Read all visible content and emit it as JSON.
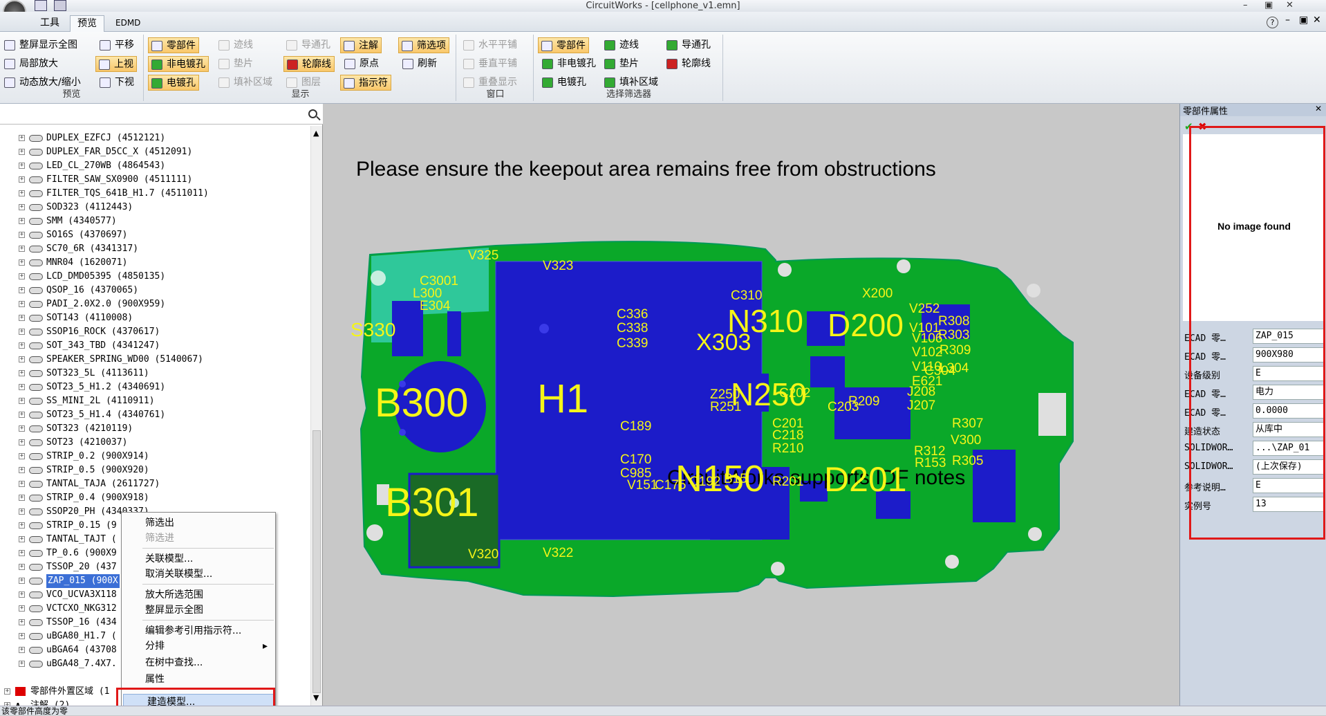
{
  "window": {
    "title": "CircuitWorks - [cellphone_v1.emn]",
    "help_glyph": "?",
    "controls": [
      "–",
      "▣",
      "✕"
    ]
  },
  "tabs": [
    "工具",
    "预览",
    "EDMD"
  ],
  "ribbon": {
    "preview_group": {
      "label": "预览",
      "items": [
        "整屏显示全图",
        "局部放大",
        "动态放大/缩小",
        "平移",
        "上视",
        "下视"
      ]
    },
    "display_group": {
      "label": "显示",
      "items": [
        "零部件",
        "非电镀孔",
        "电镀孔",
        "迹线",
        "垫片",
        "填补区域",
        "导通孔",
        "轮廓线",
        "图层",
        "注解",
        "原点",
        "指示符",
        "筛选项",
        "刷新"
      ]
    },
    "window_group": {
      "label": "窗口",
      "items": [
        "水平平铺",
        "垂直平铺",
        "重叠显示"
      ]
    },
    "filter_group": {
      "label": "选择筛选器",
      "items": [
        "零部件",
        "非电镀孔",
        "电镀孔",
        "迹线",
        "垫片",
        "填补区域",
        "导通孔",
        "轮廓线"
      ]
    }
  },
  "tree": {
    "items": [
      "DUPLEX_EZFCJ (4512121)",
      "DUPLEX_FAR_D5CC_X (4512091)",
      "LED_CL_270WB (4864543)",
      "FILTER_SAW_SX0900 (4511111)",
      "FILTER_TQS_641B_H1.7 (4511011)",
      "SOD323 (4112443)",
      "SMM (4340577)",
      "SO16S (4370697)",
      "SC70_6R (4341317)",
      "MNR04 (1620071)",
      "LCD_DMD05395 (4850135)",
      "QSOP_16 (4370065)",
      "PADI_2.0X2.0 (900X959)",
      "SOT143 (4110008)",
      "SSOP16_ROCK (4370617)",
      "SOT_343_TBD (4341247)",
      "SPEAKER_SPRING_WD00 (5140067)",
      "SOT323_5L (4113611)",
      "SOT23_5_H1.2 (4340691)",
      "SS_MINI_2L (4110911)",
      "SOT23_5_H1.4 (4340761)",
      "SOT323 (4210119)",
      "SOT23 (4210037)",
      "STRIP_0.2 (900X914)",
      "STRIP_0.5 (900X920)",
      "TANTAL_TAJA (2611727)",
      "STRIP_0.4 (900X918)",
      "SSOP20_PH (4340337)",
      "STRIP_0.15 (9",
      "TANTAL_TAJT (",
      "TP_0.6 (900X9",
      "TSSOP_20 (437",
      "ZAP_015 (900X",
      "VCO_UCVA3X118",
      "VCTCXO_NKG312",
      "TSSOP_16 (434",
      "uBGA80_H1.7 (",
      "uBGA64 (43708",
      "uBGA48_7.4X7."
    ],
    "selected_index": 32,
    "root_items": [
      "零部件外置区域 (1",
      "注解 (2)"
    ]
  },
  "context_menu": {
    "items": [
      "筛选出",
      "筛选进",
      "关联模型...",
      "取消关联模型...",
      "放大所选范围",
      "整屏显示全图",
      "编辑参考引用指示符...",
      "分排",
      "在树中查找...",
      "属性",
      "建造模型..."
    ],
    "disabled": [
      "筛选进"
    ],
    "submenu_arrow": "▸"
  },
  "canvas": {
    "note_top": "Please ensure the keepout area remains free from obstructions",
    "note_bottom": "CircuitWorks supports IDF notes",
    "big_labels": [
      "B300",
      "B301",
      "H1",
      "N310",
      "D200",
      "N250",
      "N150",
      "D201",
      "S330",
      "X303"
    ],
    "small_labels": [
      "V325",
      "V323",
      "V320",
      "V322",
      "C310",
      "X200",
      "C336",
      "C338",
      "C339",
      "V252",
      "V101",
      "R308",
      "R303",
      "V106",
      "R309",
      "V102",
      "V110",
      "L304",
      "C304",
      "E621",
      "J208",
      "J207",
      "C203",
      "R209",
      "C201",
      "C189",
      "C170",
      "C985",
      "V151",
      "C175",
      "C192",
      "B15",
      "R201",
      "R307",
      "V300",
      "R312",
      "R153",
      "R305",
      "C218",
      "R210",
      "C202",
      "Z250",
      "R251",
      "C3001",
      "L300",
      "E304"
    ]
  },
  "properties": {
    "title": "零部件属性",
    "no_image": "No image found",
    "rows": [
      {
        "label": "ECAD 零…",
        "value": "ZAP_015"
      },
      {
        "label": "ECAD 零…",
        "value": "900X980"
      },
      {
        "label": "设备级别",
        "value": "E"
      },
      {
        "label": "ECAD 零…",
        "value": "电力"
      },
      {
        "label": "ECAD 零…",
        "value": "0.0000"
      },
      {
        "label": "建造状态",
        "value": "从库中"
      },
      {
        "label": "SOLIDWOR…",
        "value": "...\\ZAP_01"
      },
      {
        "label": "SOLIDWOR…",
        "value": "(上次保存)"
      },
      {
        "label": "参考说明…",
        "value": "E"
      },
      {
        "label": "实例号",
        "value": "13"
      }
    ]
  },
  "status": {
    "text": "该零部件高度为零"
  }
}
